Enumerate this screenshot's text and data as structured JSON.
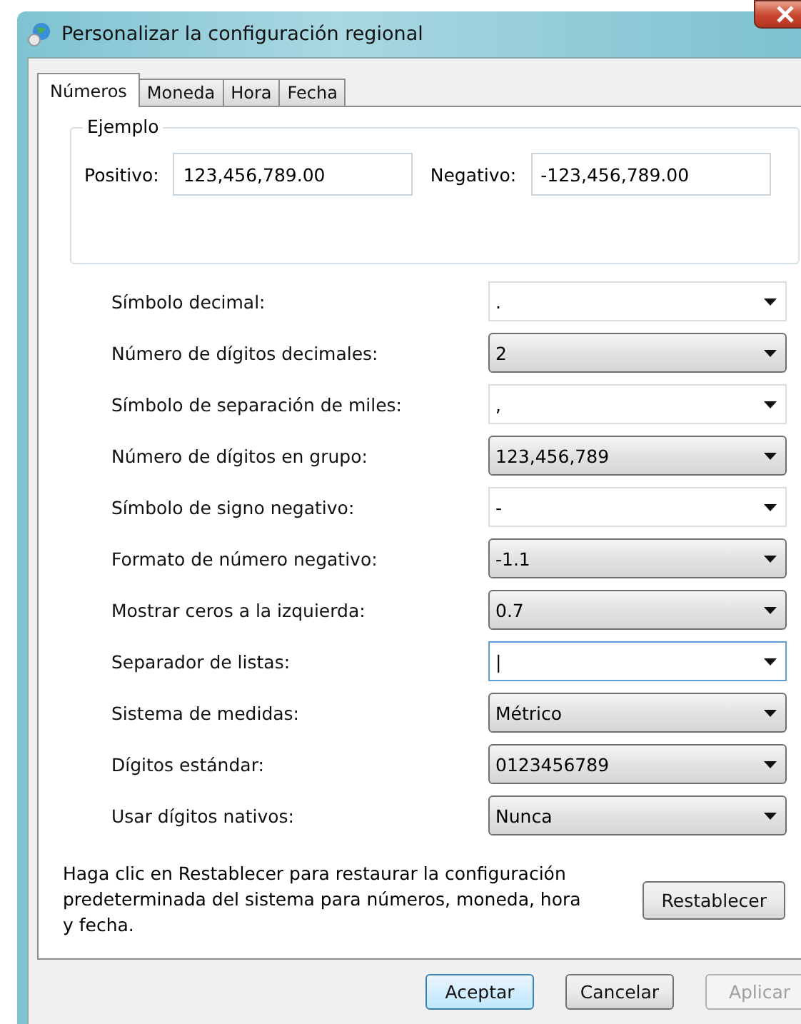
{
  "window": {
    "title": "Personalizar la configuración regional"
  },
  "tabs": [
    {
      "label": "Números",
      "selected": true
    },
    {
      "label": "Moneda",
      "selected": false
    },
    {
      "label": "Hora",
      "selected": false
    },
    {
      "label": "Fecha",
      "selected": false
    }
  ],
  "example": {
    "title": "Ejemplo",
    "positive_label": "Positivo:",
    "positive_value": "123,456,789.00",
    "negative_label": "Negativo:",
    "negative_value": "-123,456,789.00"
  },
  "settings": [
    {
      "label": "Símbolo decimal:",
      "value": ".",
      "kind": "editable",
      "focused": false
    },
    {
      "label": "Número de dígitos decimales:",
      "value": "2",
      "kind": "list",
      "focused": false
    },
    {
      "label": "Símbolo de separación de miles:",
      "value": ",",
      "kind": "editable",
      "focused": false
    },
    {
      "label": "Número de dígitos en grupo:",
      "value": "123,456,789",
      "kind": "list",
      "focused": false
    },
    {
      "label": "Símbolo de signo negativo:",
      "value": "-",
      "kind": "editable",
      "focused": false
    },
    {
      "label": "Formato de número negativo:",
      "value": "-1.1",
      "kind": "list",
      "focused": false
    },
    {
      "label": "Mostrar ceros a la izquierda:",
      "value": "0.7",
      "kind": "list",
      "focused": false
    },
    {
      "label": "Separador de listas:",
      "value": "|",
      "kind": "editable",
      "focused": true
    },
    {
      "label": "Sistema de medidas:",
      "value": "Métrico",
      "kind": "list",
      "focused": false
    },
    {
      "label": "Dígitos estándar:",
      "value": "0123456789",
      "kind": "list",
      "focused": false
    },
    {
      "label": "Usar dígitos nativos:",
      "value": "Nunca",
      "kind": "list",
      "focused": false
    }
  ],
  "reset": {
    "text": "Haga clic en Restablecer para restaurar la configuración predeterminada del sistema para números, moneda, hora y fecha.",
    "button": "Restablecer"
  },
  "buttons": [
    {
      "label": "Aceptar",
      "default": true,
      "disabled": false
    },
    {
      "label": "Cancelar",
      "default": false,
      "disabled": false
    },
    {
      "label": "Aplicar",
      "default": false,
      "disabled": true
    }
  ]
}
